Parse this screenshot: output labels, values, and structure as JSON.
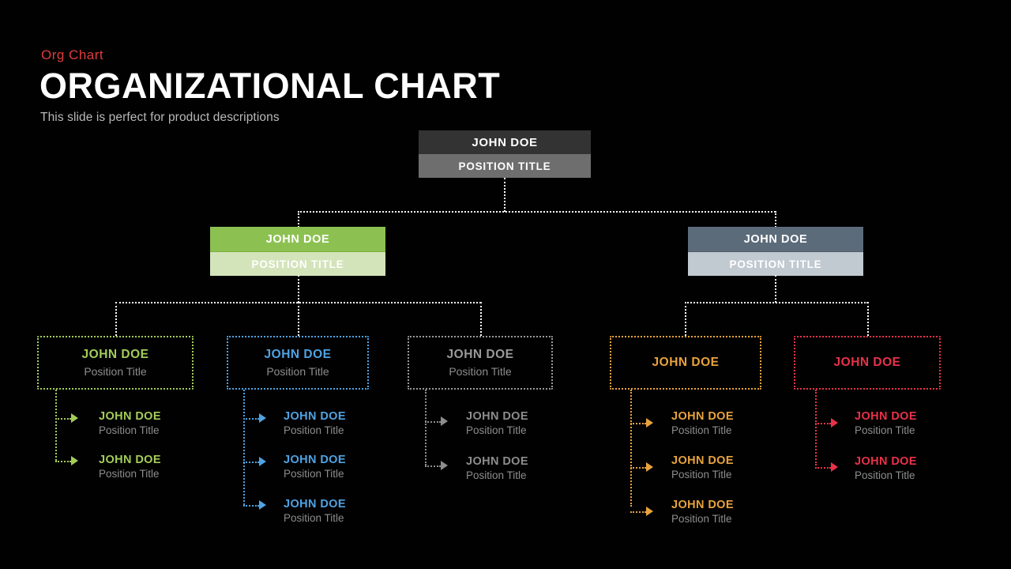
{
  "header": {
    "kicker": "Org Chart",
    "title": "ORGANIZATIONAL CHART",
    "subtitle": "This slide is perfect for product descriptions"
  },
  "colors": {
    "accent_red": "#e03b3b",
    "background": "#000000",
    "root_name_bg": "#333333",
    "root_pos_bg": "#6e6e6e",
    "green": "#8cc152",
    "green_light": "#d4e4ba",
    "slate": "#5c6b7a",
    "slate_light": "#c1c9d1",
    "branch_green": "#a4cc5a",
    "branch_blue": "#4fa3e3",
    "branch_gray": "#9a9a9a",
    "branch_orange": "#e8a33d",
    "branch_red": "#e8324a",
    "connector": "#ffffff",
    "position_text": "#8d8d8d"
  },
  "chart_data": {
    "type": "diagram",
    "title": "ORGANIZATIONAL CHART",
    "root": {
      "name": "JOHN DOE",
      "position": "POSITION TITLE"
    },
    "level2": [
      {
        "id": "green",
        "name": "JOHN DOE",
        "position": "POSITION TITLE",
        "color": "#8cc152"
      },
      {
        "id": "slate",
        "name": "JOHN DOE",
        "position": "POSITION TITLE",
        "color": "#5c6b7a"
      }
    ],
    "level3": [
      {
        "id": "dept-green",
        "name": "JOHN DOE",
        "position": "Position Title",
        "color": "#a4cc5a",
        "parent": "green",
        "leaves": [
          {
            "name": "JOHN DOE",
            "position": "Position Title"
          },
          {
            "name": "JOHN DOE",
            "position": "Position Title"
          }
        ]
      },
      {
        "id": "dept-blue",
        "name": "JOHN DOE",
        "position": "Position Title",
        "color": "#4fa3e3",
        "parent": "green",
        "leaves": [
          {
            "name": "JOHN DOE",
            "position": "Position Title"
          },
          {
            "name": "JOHN DOE",
            "position": "Position Title"
          },
          {
            "name": "JOHN DOE",
            "position": "Position Title"
          }
        ]
      },
      {
        "id": "dept-gray",
        "name": "JOHN DOE",
        "position": "Position Title",
        "color": "#9a9a9a",
        "parent": "green",
        "leaves": [
          {
            "name": "JOHN DOE",
            "position": "Position Title"
          },
          {
            "name": "JOHN DOE",
            "position": "Position Title"
          }
        ]
      },
      {
        "id": "dept-orange",
        "name": "JOHN DOE",
        "position": "",
        "color": "#e8a33d",
        "parent": "slate",
        "leaves": [
          {
            "name": "JOHN DOE",
            "position": "Position Title"
          },
          {
            "name": "JOHN DOE",
            "position": "Position Title"
          },
          {
            "name": "JOHN DOE",
            "position": "Position Title"
          }
        ]
      },
      {
        "id": "dept-red",
        "name": "JOHN DOE",
        "position": "",
        "color": "#e8324a",
        "parent": "slate",
        "leaves": [
          {
            "name": "JOHN DOE",
            "position": "Position Title"
          },
          {
            "name": "JOHN DOE",
            "position": "Position Title"
          }
        ]
      }
    ]
  }
}
